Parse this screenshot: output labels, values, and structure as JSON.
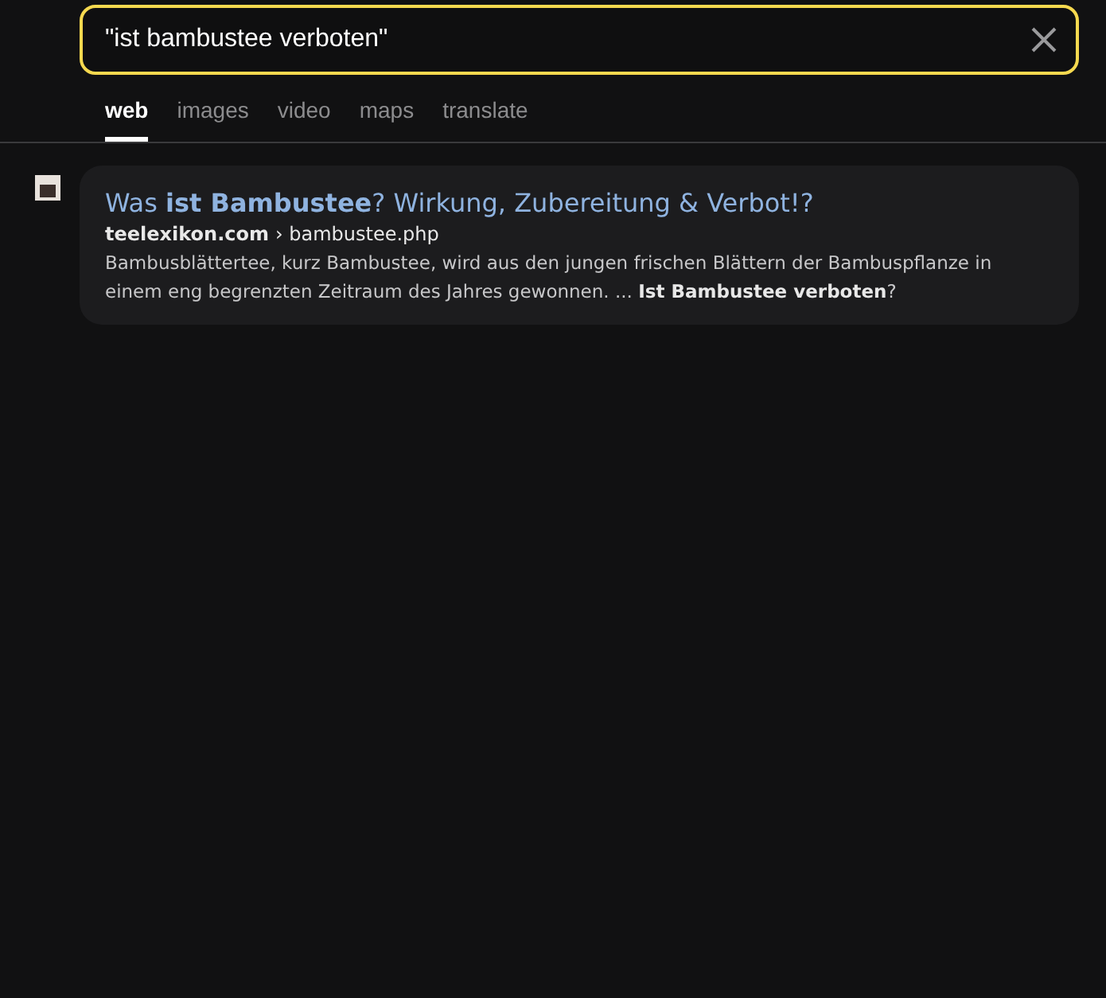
{
  "search": {
    "value": "\"ist bambustee verboten\""
  },
  "tabs": [
    {
      "label": "web",
      "selected": true
    },
    {
      "label": "images",
      "selected": false
    },
    {
      "label": "video",
      "selected": false
    },
    {
      "label": "maps",
      "selected": false
    },
    {
      "label": "translate",
      "selected": false
    }
  ],
  "results": [
    {
      "title": "Was **ist Bambustee**? Wirkung, Zubereitung & Verbot!?",
      "domain": "teelexikon.com",
      "path": "› bambustee.php",
      "snippet": "Bambusblättertee, kurz Bambustee, wird aus den jungen frischen Blättern der Bambuspflanze in einem eng begrenzten Zeitraum des Jahres gewonnen. ... **Ist Bambustee verboten**?"
    }
  ]
}
